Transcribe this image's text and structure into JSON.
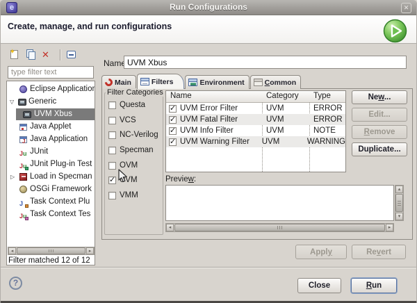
{
  "window": {
    "title": "Run Configurations",
    "close_glyph": "✕"
  },
  "header": {
    "title": "Create, manage, and run configurations",
    "icon": "run-play-icon"
  },
  "colors": {
    "dialog_bg": "#d8d4ce",
    "selection_bg": "#7a7a7a",
    "delete_red": "#c23128",
    "play_green": "#55a944",
    "titlebar_gray": "#9c9995"
  },
  "sidebar": {
    "toolbar": {
      "icons": [
        "new-configuration-icon",
        "duplicate-configuration-icon",
        "delete-configuration-icon",
        "collapse-all-icon"
      ]
    },
    "filter": {
      "placeholder": "type filter text"
    },
    "tree": {
      "items": [
        {
          "label": "Eclipse Application",
          "icon": "eclipse-application-icon"
        },
        {
          "label": "Generic",
          "icon": "generic-type-icon",
          "expanded": true
        },
        {
          "label": "UVM Xbus",
          "icon": "generic-config-icon",
          "selected": true
        },
        {
          "label": "Java Applet",
          "icon": "java-applet-icon"
        },
        {
          "label": "Java Application",
          "icon": "java-application-icon"
        },
        {
          "label": "JUnit",
          "icon": "junit-icon"
        },
        {
          "label": "JUnit Plug-in Test",
          "icon": "junit-plugin-test-icon"
        },
        {
          "label": "Load in Specman",
          "icon": "load-in-specman-icon",
          "collapsed": true
        },
        {
          "label": "OSGi Framework",
          "icon": "osgi-framework-icon"
        },
        {
          "label": "Task Context Plu",
          "icon": "task-context-plugin-icon"
        },
        {
          "label": "Task Context Tes",
          "icon": "task-context-test-icon"
        }
      ]
    },
    "status": "Filter matched 12 of 12"
  },
  "main": {
    "name": {
      "label": "Name:",
      "value": "UVM Xbus"
    },
    "tabs": [
      {
        "label": "Main",
        "icon": "main-tab-icon"
      },
      {
        "label": "Filters",
        "icon": "filters-tab-icon",
        "active": true
      },
      {
        "label": "Environment",
        "icon": "environment-tab-icon"
      },
      {
        "pre": "",
        "mn": "C",
        "post": "ommon",
        "icon": "common-tab-icon"
      }
    ],
    "filter_categories": {
      "title": "Filter Categories",
      "items": [
        {
          "label": "Questa",
          "checked": false
        },
        {
          "label": "VCS",
          "checked": false
        },
        {
          "label": "NC-Verilog",
          "checked": false
        },
        {
          "label": "Specman",
          "checked": false
        },
        {
          "label": "OVM",
          "checked": false
        },
        {
          "label": "UVM",
          "checked": true
        },
        {
          "label": "VMM",
          "checked": false
        }
      ]
    },
    "table": {
      "columns": [
        "Name",
        "Category",
        "Type"
      ],
      "rows": [
        {
          "checked": true,
          "name": "UVM Error Filter",
          "category": "UVM",
          "type": "ERROR"
        },
        {
          "checked": true,
          "name": "UVM Fatal Filter",
          "category": "UVM",
          "type": "ERROR"
        },
        {
          "checked": true,
          "name": "UVM Info Filter",
          "category": "UVM",
          "type": "NOTE"
        },
        {
          "checked": true,
          "name": "UVM Warning Filter",
          "category": "UVM",
          "type": "WARNING"
        }
      ]
    },
    "actions": {
      "new": {
        "pre": "Ne",
        "mn": "w",
        "post": "...",
        "enabled": true
      },
      "edit": {
        "label": "Edit...",
        "enabled": false
      },
      "remove": {
        "pre": "",
        "mn": "R",
        "post": "emove",
        "enabled": false
      },
      "duplicate": {
        "label": "Duplicate...",
        "enabled": true
      }
    },
    "preview": {
      "pre": "Previe",
      "mn": "w",
      "post": ":"
    },
    "apply": {
      "pre": "Appl",
      "mn": "y",
      "post": "",
      "enabled": false
    },
    "revert": {
      "pre": "Re",
      "mn": "v",
      "post": "ert",
      "enabled": false
    }
  },
  "footer": {
    "help": "?",
    "close": "Close",
    "run": {
      "pre": "",
      "mn": "R",
      "post": "un"
    }
  }
}
